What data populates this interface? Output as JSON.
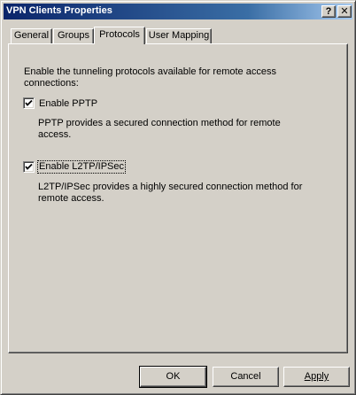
{
  "window": {
    "title": "VPN Clients Properties",
    "help_glyph": "?",
    "close_glyph": "✕"
  },
  "tabs": [
    {
      "label": "General"
    },
    {
      "label": "Groups"
    },
    {
      "label": "Protocols",
      "selected": true
    },
    {
      "label": "User Mapping"
    }
  ],
  "protocols": {
    "intro": "Enable the tunneling protocols available for remote access connections:",
    "pptp": {
      "label": "Enable PPTP",
      "checked": true,
      "description": "PPTP provides a secured connection method for remote access."
    },
    "l2tp": {
      "label": "Enable L2TP/IPSec",
      "checked": true,
      "description": "L2TP/IPSec provides a highly secured connection method for remote access."
    }
  },
  "buttons": {
    "ok": "OK",
    "cancel": "Cancel",
    "apply": "Apply"
  }
}
